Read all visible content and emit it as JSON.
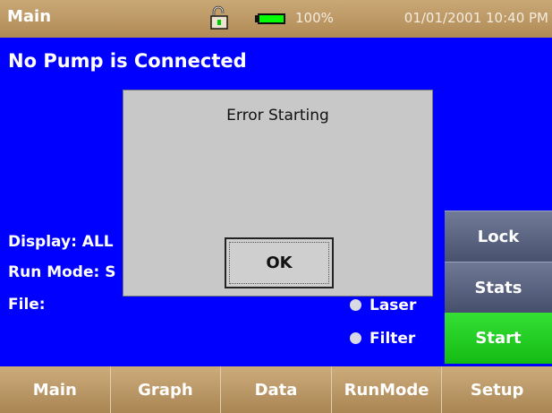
{
  "status_bar": {
    "title": "Main",
    "battery_percent": "100%",
    "datetime": "01/01/2001 10:40 PM",
    "lock_icon": "unlocked-padlock-icon",
    "battery_icon": "battery-full-icon",
    "battery_color": "#00ff00"
  },
  "main": {
    "heading": "No Pump is Connected",
    "display_label": "Display: ALL",
    "run_mode_label": "Run Mode: S",
    "file_label": "File:",
    "indicators": [
      {
        "label": "Laser"
      },
      {
        "label": "Filter"
      }
    ]
  },
  "side_buttons": {
    "lock": "Lock",
    "stats": "Stats",
    "start": "Start",
    "start_color": "#22cc22"
  },
  "dialog": {
    "title": "Error Starting",
    "ok_label": "OK"
  },
  "bottom_nav": {
    "tabs": [
      "Main",
      "Graph",
      "Data",
      "RunMode",
      "Setup"
    ]
  }
}
